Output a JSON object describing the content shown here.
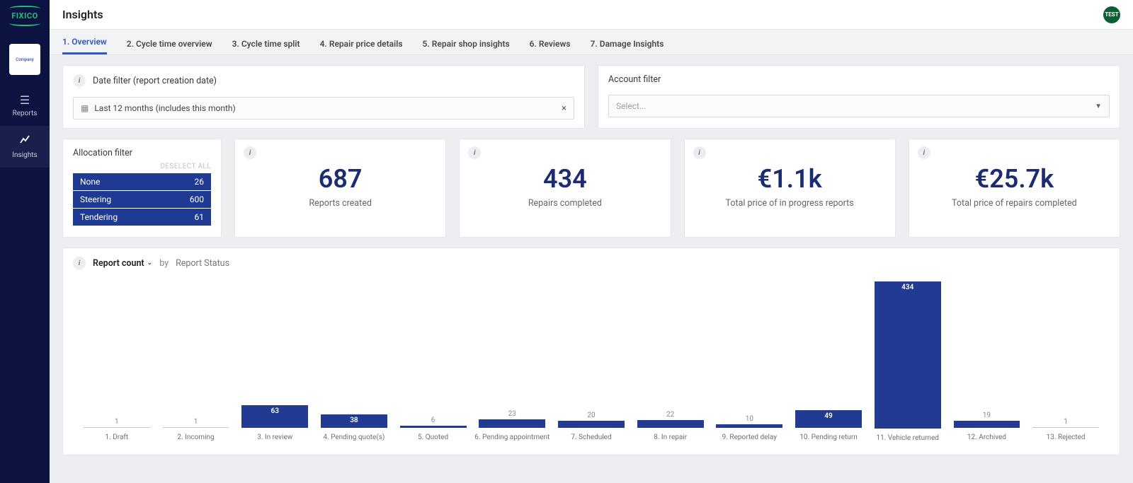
{
  "brand": "FIXICO",
  "company_logo_text": "Company",
  "header": {
    "title": "Insights",
    "avatar_text": "TEST"
  },
  "sidebar": {
    "items": [
      {
        "label": "Reports"
      },
      {
        "label": "Insights"
      }
    ]
  },
  "tabs": [
    {
      "label": "1. Overview",
      "active": true
    },
    {
      "label": "2. Cycle time overview"
    },
    {
      "label": "3. Cycle time split"
    },
    {
      "label": "4. Repair price details"
    },
    {
      "label": "5. Repair shop insights"
    },
    {
      "label": "6. Reviews"
    },
    {
      "label": "7. Damage Insights"
    }
  ],
  "filters": {
    "date": {
      "title": "Date filter (report creation date)",
      "value": "Last 12 months (includes this month)"
    },
    "account": {
      "title": "Account filter",
      "placeholder": "Select..."
    },
    "allocation": {
      "title": "Allocation filter",
      "deselect": "DESELECT ALL",
      "items": [
        {
          "name": "None",
          "count": "26"
        },
        {
          "name": "Steering",
          "count": "600"
        },
        {
          "name": "Tendering",
          "count": "61"
        }
      ]
    }
  },
  "kpis": [
    {
      "value": "687",
      "label": "Reports created"
    },
    {
      "value": "434",
      "label": "Repairs completed"
    },
    {
      "value": "€1.1k",
      "label": "Total price of in progress reports"
    },
    {
      "value": "€25.7k",
      "label": "Total price of repairs completed"
    }
  ],
  "chart": {
    "metric": "Report count",
    "by": "by",
    "dimension": "Report Status"
  },
  "chart_data": {
    "type": "bar",
    "title": "Report count by Report Status",
    "xlabel": "Report Status",
    "ylabel": "Report count",
    "ylim": [
      0,
      434
    ],
    "categories": [
      "1. Draft",
      "2. Incoming",
      "3. In review",
      "4. Pending quote(s)",
      "5. Quoted",
      "6. Pending appointment",
      "7. Scheduled",
      "8. In repair",
      "9. Reported delay",
      "10. Pending return",
      "11. Vehicle returned",
      "12. Archived",
      "13. Rejected"
    ],
    "values": [
      1,
      1,
      63,
      38,
      6,
      23,
      20,
      22,
      10,
      49,
      434,
      19,
      1
    ]
  }
}
